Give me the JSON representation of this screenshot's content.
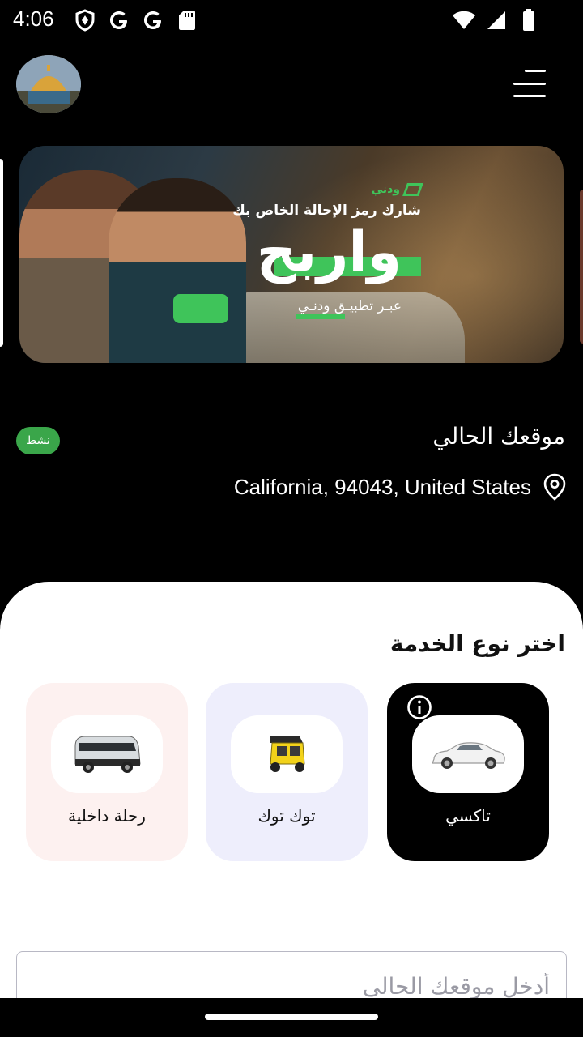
{
  "status_bar": {
    "time": "4:06",
    "left_icons": [
      "shield-icon",
      "google-icon",
      "google-icon",
      "sd-card-icon"
    ],
    "right_icons": [
      "wifi-icon",
      "signal-icon",
      "battery-icon"
    ]
  },
  "header": {
    "avatar": "dome-photo",
    "menu_icon": "hamburger-menu-icon"
  },
  "banner": {
    "brand": "ودني",
    "line1": "شارك رمز الإحالة الخاص بك",
    "headline": "واربح",
    "line3": "عبـر تطبيـق ودنـي",
    "accent_color": "#3fc45a"
  },
  "location": {
    "status_badge": "نشط",
    "title": "موقعك الحالي",
    "address": "California, 94043, United States",
    "badge_color": "#3aa64a"
  },
  "services": {
    "title": "اختر نوع الخدمة",
    "items": [
      {
        "label": "تاكسي",
        "icon": "car-icon",
        "selected": true
      },
      {
        "label": "توك توك",
        "icon": "tuktuk-icon",
        "selected": false
      },
      {
        "label": "رحلة داخلية",
        "icon": "van-icon",
        "selected": false
      }
    ]
  },
  "search": {
    "placeholder": "أدخل موقعك الحالي"
  }
}
